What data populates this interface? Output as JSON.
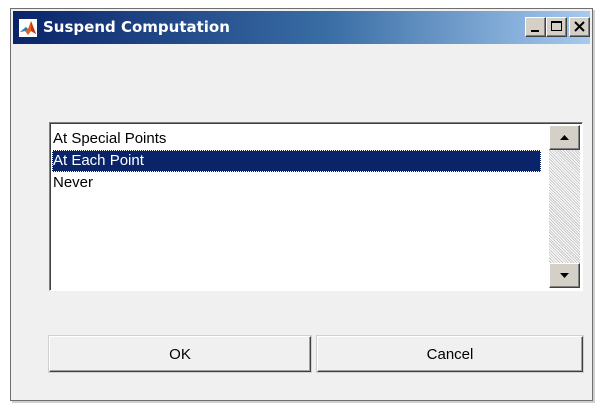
{
  "window": {
    "title": "Suspend Computation",
    "app_icon": "matlab-logo-icon",
    "controls": [
      "minimize-icon",
      "maximize-icon",
      "close-icon"
    ]
  },
  "listbox": {
    "items": [
      {
        "label": "At Special Points",
        "selected": false
      },
      {
        "label": "At Each Point",
        "selected": true
      },
      {
        "label": "Never",
        "selected": false
      }
    ]
  },
  "buttons": {
    "ok_label": "OK",
    "cancel_label": "Cancel"
  },
  "colors": {
    "titlebar_start": "#0a246a",
    "titlebar_end": "#a6caf0",
    "selection": "#0a246a",
    "dialog_bg": "#f0f0f0"
  }
}
